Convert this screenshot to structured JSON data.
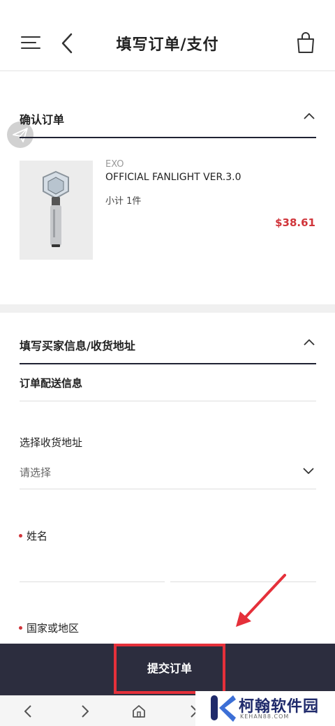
{
  "header": {
    "title": "填写订单/支付",
    "menu_icon": "menu-icon",
    "back_icon": "back-icon",
    "bag_icon": "shopping-bag-icon"
  },
  "order_section": {
    "title": "确认订单",
    "chevron_icon": "chevron-up-icon",
    "product": {
      "brand": "EXO",
      "name": "OFFICIAL FANLIGHT VER.3.0",
      "subtotal": "小计 1件",
      "price": "$38.61"
    }
  },
  "buyer_section": {
    "title": "填写买家信息/收货地址",
    "chevron_icon": "chevron-up-icon",
    "delivery_title": "订单配送信息",
    "address_label": "选择收货地址",
    "address_value": "请选择",
    "name_label": "姓名",
    "country_label": "国家或地区"
  },
  "submit": {
    "label": "提交订单"
  },
  "browser_nav": {
    "icons": [
      "back-arrow-icon",
      "forward-arrow-icon",
      "home-icon",
      "forward-arrow-icon"
    ]
  },
  "watermark": {
    "text": "柯翰软件园",
    "sub": "KEHAN88.COM"
  },
  "colors": {
    "accent_dark": "#2c2d3e",
    "price_red": "#d0343a",
    "highlight_red": "#e5303a"
  }
}
